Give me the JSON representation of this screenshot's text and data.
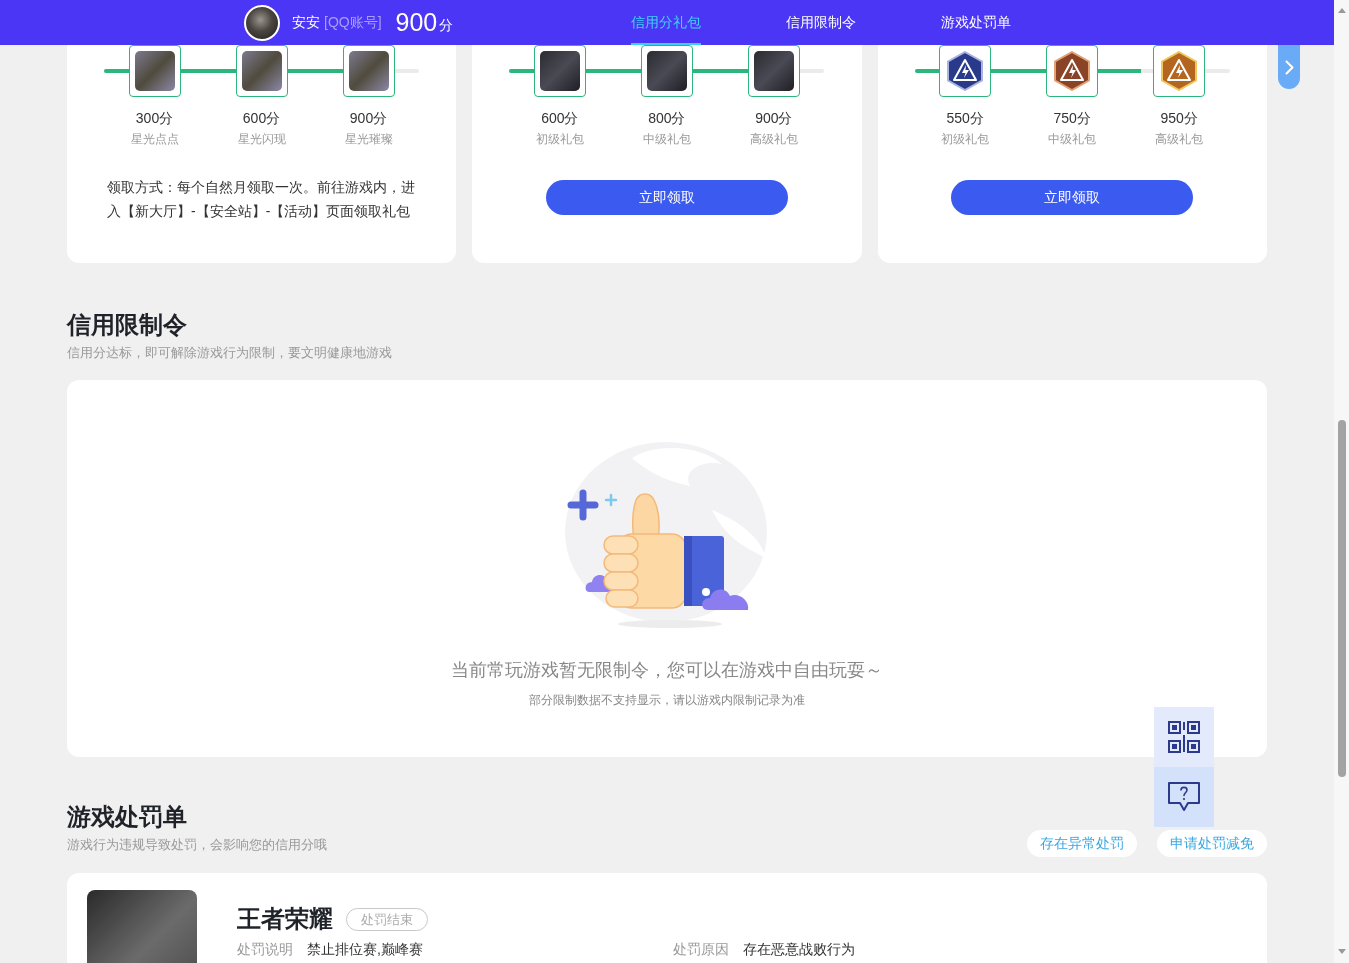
{
  "header": {
    "user_name": "安安",
    "account_type": "[QQ账号]",
    "score": "900",
    "score_unit": "分",
    "tabs": [
      {
        "label": "信用分礼包",
        "selected": true
      },
      {
        "label": "信用限制令",
        "selected": false
      },
      {
        "label": "游戏处罚单",
        "selected": false
      }
    ]
  },
  "gift_cards": [
    {
      "progress": {
        "level": 0.84
      },
      "rewards": [
        {
          "kind": "image",
          "points": "300分",
          "name": "星光点点"
        },
        {
          "kind": "image",
          "points": "600分",
          "name": "星光闪现"
        },
        {
          "kind": "image",
          "points": "900分",
          "name": "星光璀璨"
        }
      ],
      "note": "领取方式：每个自然月领取一次。前往游戏内，进入【新大厅】-【安全站】-【活动】页面领取礼包"
    },
    {
      "progress": {
        "level": 0.84
      },
      "rewards": [
        {
          "kind": "image",
          "points": "600分",
          "name": "初级礼包"
        },
        {
          "kind": "image",
          "points": "800分",
          "name": "中级礼包"
        },
        {
          "kind": "image",
          "points": "900分",
          "name": "高级礼包"
        }
      ],
      "button": "立即领取"
    },
    {
      "progress": {
        "level": 0.72
      },
      "rewards": [
        {
          "kind": "emblem",
          "points": "550分",
          "name": "初级礼包"
        },
        {
          "kind": "emblem",
          "points": "750分",
          "name": "中级礼包"
        },
        {
          "kind": "emblem",
          "points": "950分",
          "name": "高级礼包"
        }
      ],
      "button": "立即领取"
    }
  ],
  "restrictions": {
    "title": "信用限制令",
    "subtitle": "信用分达标，即可解除游戏行为限制，要文明健康地游戏",
    "empty_message": "当前常玩游戏暂无限制令，您可以在游戏中自由玩耍～",
    "empty_note": "部分限制数据不支持显示，请以游戏内限制记录为准"
  },
  "penalties": {
    "title": "游戏处罚单",
    "subtitle": "游戏行为违规导致处罚，会影响您的信用分哦",
    "actions": [
      "存在异常处罚",
      "申请处罚减免"
    ],
    "items": [
      {
        "game": "王者荣耀",
        "status": "处罚结束",
        "fields": [
          {
            "label": "处罚说明",
            "value": "禁止排位赛,巅峰赛"
          },
          {
            "label": "处罚原因",
            "value": "存在恶意战败行为"
          }
        ]
      }
    ]
  }
}
